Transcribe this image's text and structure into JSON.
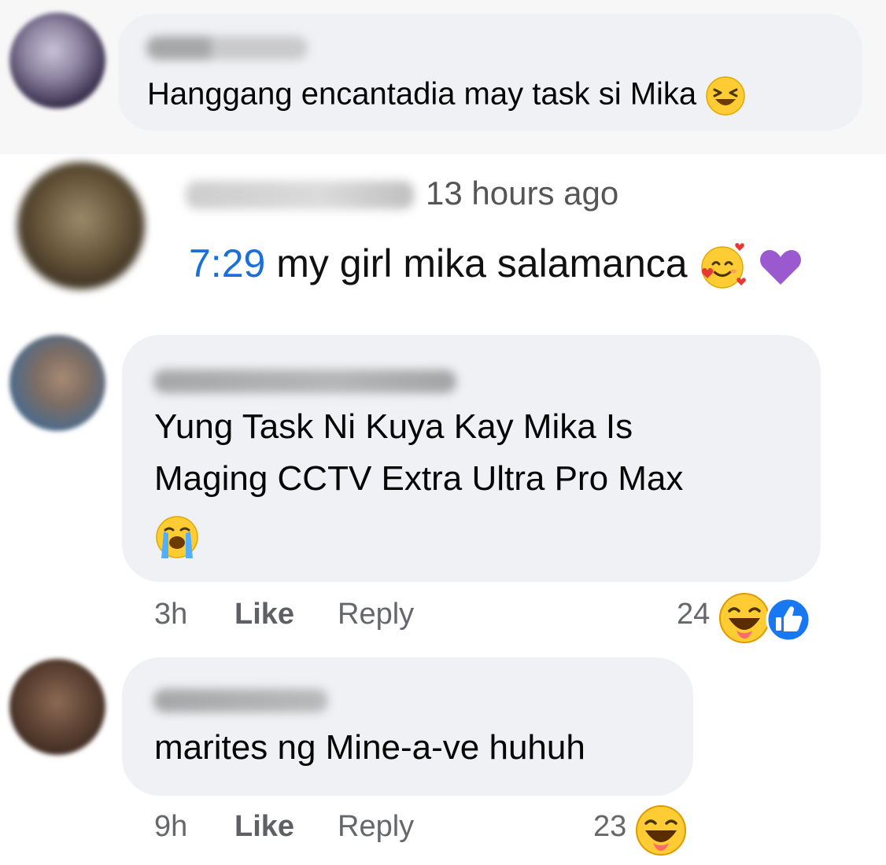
{
  "comments": [
    {
      "text": "Hanggang encantadia may task si Mika",
      "emoji": "laughing-squint-emoji"
    },
    {
      "time": "13 hours ago",
      "timestamp": "7:29",
      "text": " my girl mika salamanca ",
      "emoji1": "smiling-face-with-hearts-emoji",
      "emoji2": "purple-heart-emoji"
    },
    {
      "line1": "Yung Task Ni Kuya Kay Mika Is",
      "line2": "Maging CCTV Extra Ultra Pro Max",
      "emoji": "loudly-crying-emoji",
      "age": "3h",
      "like_label": "Like",
      "reply_label": "Reply",
      "reaction_count": "24",
      "reactions": [
        "haha-reaction-icon",
        "like-reaction-icon"
      ]
    },
    {
      "text": "marites ng Mine-a-ve huhuh",
      "age": "9h",
      "like_label": "Like",
      "reply_label": "Reply",
      "reaction_count": "23",
      "reactions": [
        "haha-reaction-icon"
      ]
    }
  ],
  "colors": {
    "bubble": "#eff1f4",
    "timestamp_link": "#1a6fd8",
    "meta_text": "#65676b",
    "like_blue": "#1877f2"
  }
}
